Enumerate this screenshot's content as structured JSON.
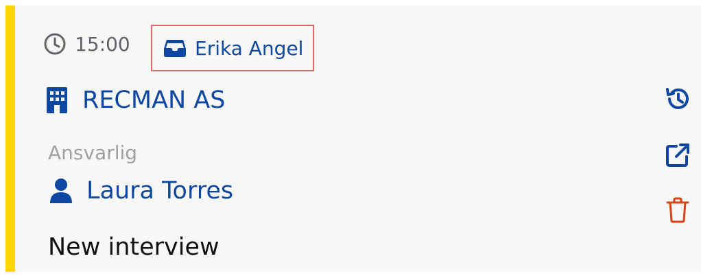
{
  "appointment": {
    "time": "15:00",
    "owner_name": "Erika Angel",
    "company_name": "RECMAN AS",
    "responsible_label": "Ansvarlig",
    "responsible_name": "Laura Torres",
    "title": "New interview"
  },
  "icons": {
    "clock": "clock-icon",
    "inbox": "inbox-icon",
    "building": "building-icon",
    "user": "user-icon",
    "history": "history-icon",
    "open": "external-link-icon",
    "delete": "trash-icon"
  },
  "colors": {
    "accent": "#ffd500",
    "link": "#0d47a1",
    "muted": "#a0a0a0",
    "delete": "#d84315",
    "highlight_border": "#e06666"
  }
}
